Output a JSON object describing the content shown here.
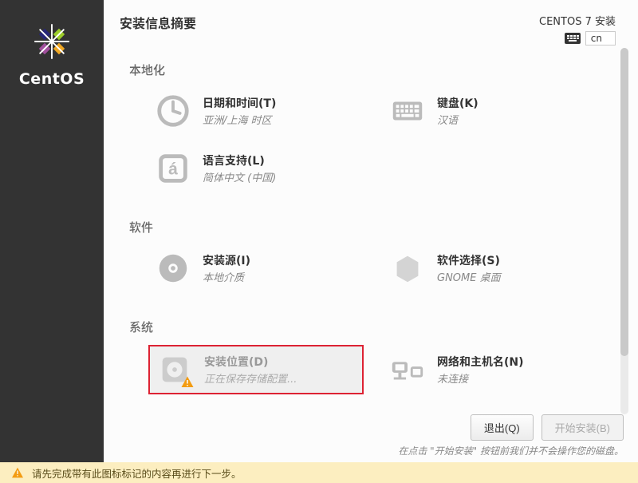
{
  "brand": "CentOS",
  "header": {
    "title": "安装信息摘要",
    "product": "CENTOS 7 安装",
    "lang_code": "cn"
  },
  "sections": [
    {
      "title": "本地化",
      "items": [
        {
          "id": "datetime",
          "title": "日期和时间(T)",
          "sub": "亚洲/上海 时区"
        },
        {
          "id": "keyboard",
          "title": "键盘(K)",
          "sub": "汉语"
        },
        {
          "id": "language",
          "title": "语言支持(L)",
          "sub": "简体中文 (中国)"
        }
      ]
    },
    {
      "title": "软件",
      "items": [
        {
          "id": "source",
          "title": "安装源(I)",
          "sub": "本地介质"
        },
        {
          "id": "software",
          "title": "软件选择(S)",
          "sub": "GNOME 桌面"
        }
      ]
    },
    {
      "title": "系统",
      "items": [
        {
          "id": "destination",
          "title": "安装位置(D)",
          "sub": "正在保存存储配置...",
          "highlighted": true,
          "warning": true
        },
        {
          "id": "network",
          "title": "网络和主机名(N)",
          "sub": "未连接"
        }
      ]
    }
  ],
  "footer": {
    "quit": "退出(Q)",
    "begin": "开始安装(B)",
    "hint": "在点击 \"开始安装\" 按钮前我们并不会操作您的磁盘。"
  },
  "warning_bar": "请先完成带有此图标标记的内容再进行下一步。"
}
